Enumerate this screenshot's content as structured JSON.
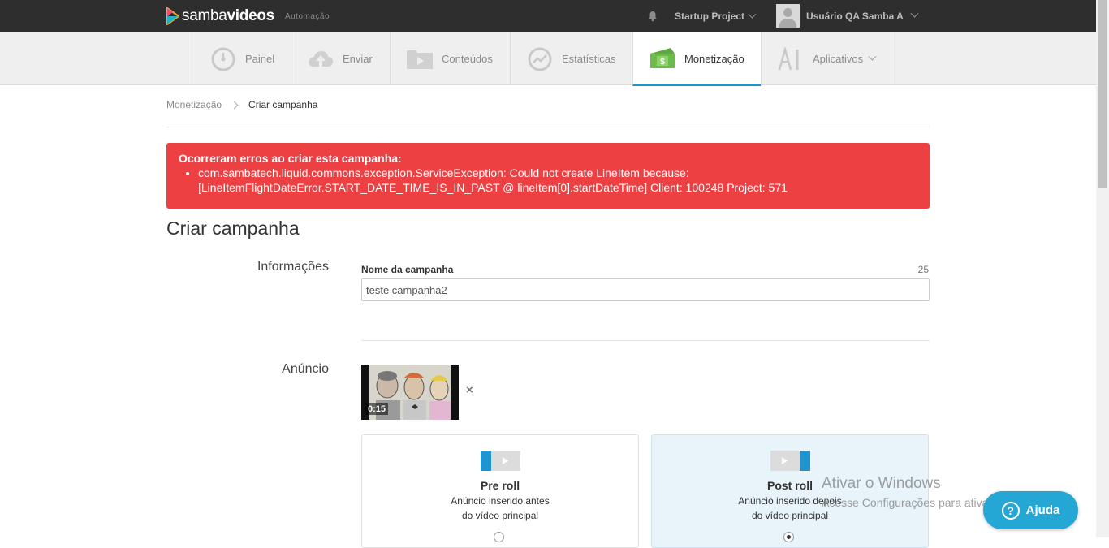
{
  "topbar": {
    "logo_prefix": "samba",
    "logo_bold": "videos",
    "logo_sub": "Automação",
    "project": "Startup Project",
    "user": "Usuário QA Samba A"
  },
  "nav": {
    "items": [
      {
        "label": "Painel",
        "icon": "gauge-icon"
      },
      {
        "label": "Enviar",
        "icon": "cloud-upload-icon"
      },
      {
        "label": "Conteúdos",
        "icon": "folder-play-icon"
      },
      {
        "label": "Estatísticas",
        "icon": "chart-icon"
      },
      {
        "label": "Monetização",
        "icon": "money-icon"
      },
      {
        "label": "Aplicativos",
        "icon": "apps-icon"
      }
    ],
    "active": "Monetização"
  },
  "breadcrumb": {
    "parent": "Monetização",
    "current": "Criar campanha"
  },
  "alert": {
    "title": "Ocorreram erros ao criar esta campanha:",
    "errors": [
      "com.sambatech.liquid.commons.exception.ServiceException: Could not create LineItem because: [LineItemFlightDateError.START_DATE_TIME_IS_IN_PAST @ lineItem[0].startDateTime] Client: 100248 Project: 571"
    ],
    "color": "#ec4043"
  },
  "page": {
    "title": "Criar campanha"
  },
  "info": {
    "section_label": "Informações",
    "field_label": "Nome da campanha",
    "char_count": "25",
    "value": "teste campanha2"
  },
  "ad": {
    "section_label": "Anúncio",
    "duration": "0:15",
    "remove": "×",
    "cards": [
      {
        "title": "Pre roll",
        "desc1": "Anúncio inserido antes",
        "desc2": "do vídeo principal",
        "selected": false
      },
      {
        "title": "Post roll",
        "desc1": "Anúncio inserido depois",
        "desc2": "do vídeo principal",
        "selected": true
      }
    ]
  },
  "watermark": {
    "line1": "Ativar o Windows",
    "line2": "Acesse Configurações para ativar o Windows."
  },
  "help": {
    "label": "Ajuda",
    "icon_glyph": "?"
  },
  "colors": {
    "accent": "#1e95cf",
    "topbar": "#2e2e2e",
    "help": "#25a7d6"
  }
}
